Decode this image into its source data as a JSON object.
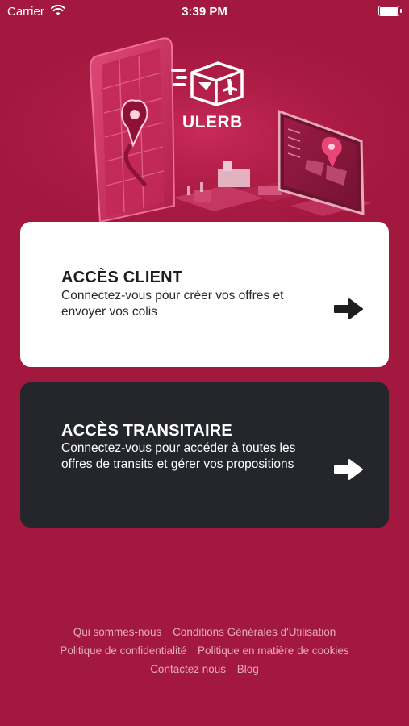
{
  "status_bar": {
    "carrier": "Carrier",
    "time": "3:39 PM"
  },
  "brand": {
    "name": "ULERB"
  },
  "cards": {
    "client": {
      "title": "ACCÈS CLIENT",
      "description": "Connectez-vous pour créer vos offres et envoyer vos colis"
    },
    "transitaire": {
      "title": "ACCÈS TRANSITAIRE",
      "description": "Connectez-vous pour accéder à toutes les offres de transits et gérer vos propositions"
    }
  },
  "footer": {
    "links": [
      "Qui sommes-nous",
      "Conditions Générales d'Utilisation",
      "Politique de confidentialité",
      "Politique en matière de cookies",
      "Contactez nous",
      "Blog"
    ]
  },
  "colors": {
    "background": "#a3183f",
    "card_client": "#ffffff",
    "card_transit": "#24262b",
    "footer_text": "#e7aabd"
  },
  "icons": [
    "wifi-icon",
    "battery-icon",
    "delivery-box-icon",
    "arrow-right-icon"
  ]
}
